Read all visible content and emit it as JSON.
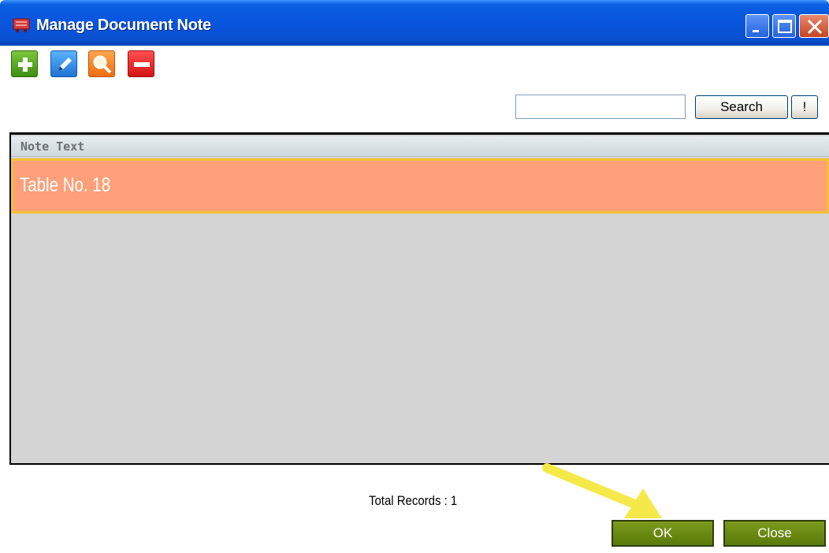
{
  "window": {
    "title": "Manage Document Note"
  },
  "toolbar": {
    "items": [
      {
        "icon": "plus-icon",
        "color": "#4fa421"
      },
      {
        "icon": "pencil-icon",
        "color": "#2b8ae8"
      },
      {
        "icon": "magnifier-icon",
        "color": "#f7861c"
      },
      {
        "icon": "minus-icon",
        "color": "#e02424"
      }
    ]
  },
  "search": {
    "value": "",
    "button_label": "Search",
    "extra_button_label": "!"
  },
  "grid": {
    "columns": [
      "Note Text"
    ],
    "rows": [
      {
        "note_text": "Table No. 18",
        "selected": true
      }
    ],
    "selected_row_color": "#ffa07a",
    "selected_row_border": "#f2c230"
  },
  "footer": {
    "total_records": "Total Records : 1",
    "ok_label": "OK",
    "close_label": "Close"
  },
  "annotation": {
    "arrow_color": "#f5e94a"
  }
}
